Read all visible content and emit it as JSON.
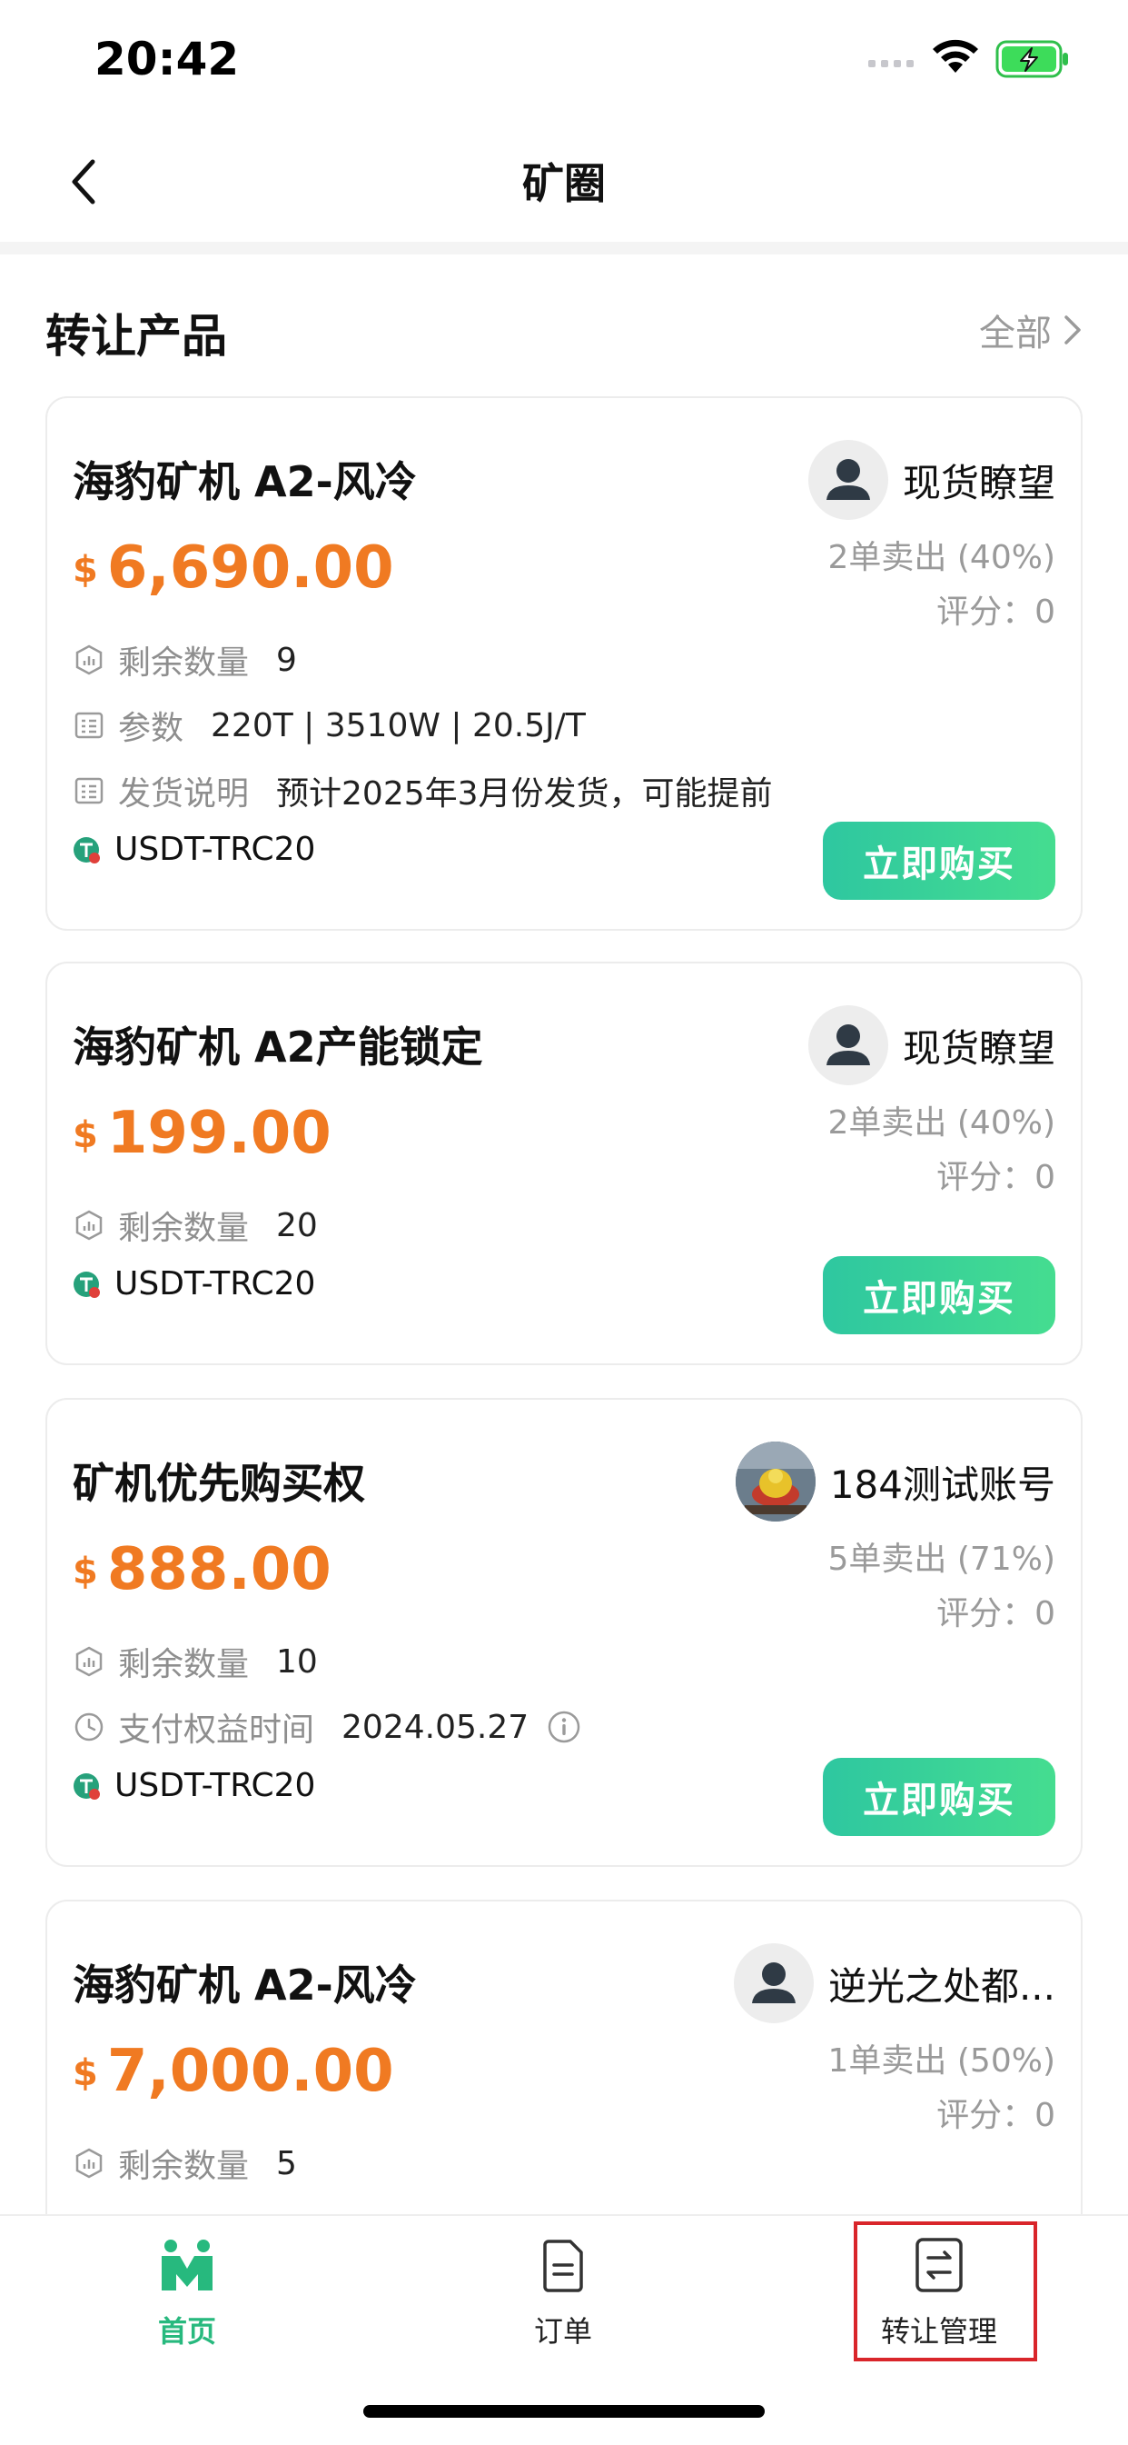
{
  "status_bar": {
    "time": "20:42"
  },
  "nav": {
    "title": "矿圈"
  },
  "section": {
    "title": "转让产品",
    "all_label": "全部"
  },
  "cards": [
    {
      "title": "海豹矿机 A2-风冷",
      "currency_symbol": "$",
      "price": "6,690.00",
      "seller_name": "现货瞭望",
      "sold": "2单卖出 (40%)",
      "rating": "评分：0",
      "rows": [
        {
          "label": "剩余数量",
          "value": "9"
        },
        {
          "label": "参数",
          "value": "220T | 3510W | 20.5J/T"
        },
        {
          "label": "发货说明",
          "value": "预计2025年3月份发货，可能提前"
        }
      ],
      "token": "USDT-TRC20",
      "buy_label": "立即购买"
    },
    {
      "title": "海豹矿机 A2产能锁定",
      "currency_symbol": "$",
      "price": "199.00",
      "seller_name": "现货瞭望",
      "sold": "2单卖出 (40%)",
      "rating": "评分：0",
      "rows": [
        {
          "label": "剩余数量",
          "value": "20"
        }
      ],
      "token": "USDT-TRC20",
      "buy_label": "立即购买"
    },
    {
      "title": "矿机优先购买权",
      "currency_symbol": "$",
      "price": "888.00",
      "seller_name": "184测试账号",
      "sold": "5单卖出 (71%)",
      "rating": "评分：0",
      "rows": [
        {
          "label": "剩余数量",
          "value": "10"
        },
        {
          "label": "支付权益时间",
          "value": "2024.05.27"
        }
      ],
      "token": "USDT-TRC20",
      "buy_label": "立即购买"
    },
    {
      "title": "海豹矿机 A2-风冷",
      "currency_symbol": "$",
      "price": "7,000.00",
      "seller_name": "逆光之处都...",
      "sold": "1单卖出 (50%)",
      "rating": "评分：0",
      "rows": [
        {
          "label": "剩余数量",
          "value": "5"
        }
      ]
    }
  ],
  "tabbar": {
    "items": [
      {
        "label": "首页",
        "icon": "home-icon",
        "active": true
      },
      {
        "label": "订单",
        "icon": "order-icon",
        "active": false
      },
      {
        "label": "转让管理",
        "icon": "transfer-icon",
        "active": false
      }
    ]
  },
  "colors": {
    "accent": "#27b97e",
    "price": "#f07a22",
    "button": "#3ad39a",
    "highlight": "#d9252a"
  }
}
